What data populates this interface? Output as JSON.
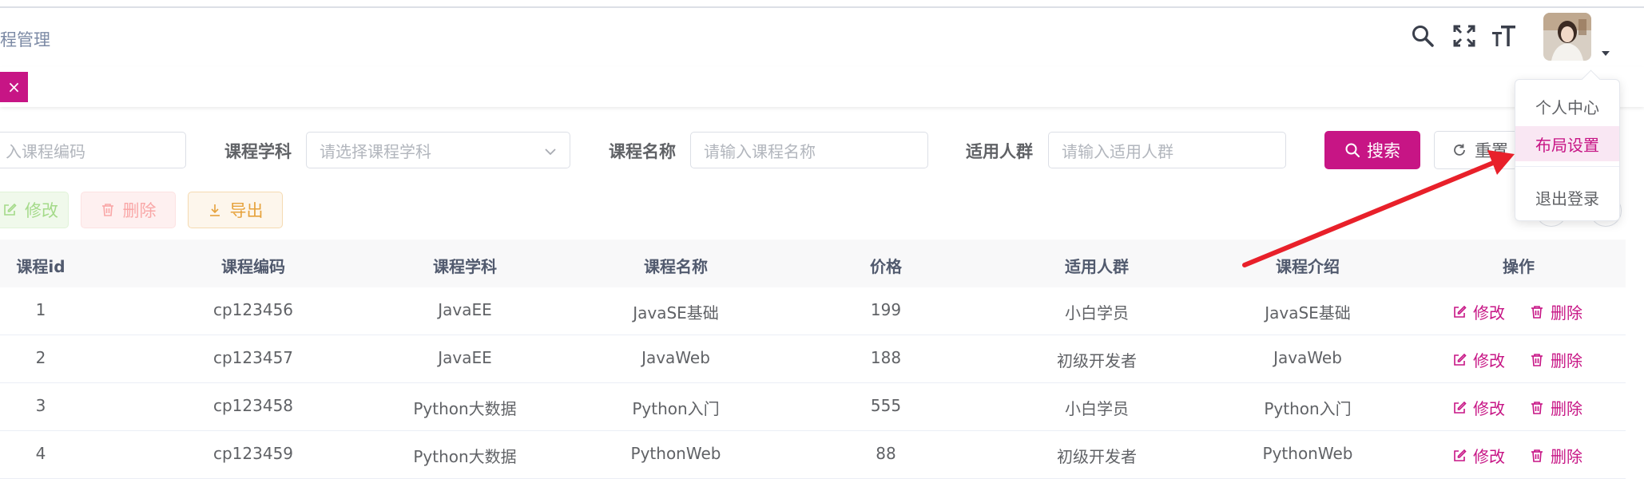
{
  "header": {
    "breadcrumb": "程管理",
    "icons": [
      "search-icon",
      "fullscreen-icon",
      "font-size-icon",
      "chevron-down-icon"
    ]
  },
  "tags": {
    "active_close": "×"
  },
  "search": {
    "code_placeholder": "入课程编码",
    "subject_label": "课程学科",
    "subject_placeholder": "请选择课程学科",
    "name_label": "课程名称",
    "name_placeholder": "请输入课程名称",
    "audience_label": "适用人群",
    "audience_placeholder": "请输入适用人群",
    "search_button": "搜索",
    "reset_button": "重置"
  },
  "toolbar": {
    "edit": "修改",
    "delete": "删除",
    "export": "导出"
  },
  "table": {
    "columns": [
      "课程id",
      "课程编码",
      "课程学科",
      "课程名称",
      "价格",
      "适用人群",
      "课程介绍",
      "操作"
    ],
    "rows": [
      [
        "1",
        "cp123456",
        "JavaEE",
        "JavaSE基础",
        "199",
        "小白学员",
        "JavaSE基础"
      ],
      [
        "2",
        "cp123457",
        "JavaEE",
        "JavaWeb",
        "188",
        "初级开发者",
        "JavaWeb"
      ],
      [
        "3",
        "cp123458",
        "Python大数据",
        "Python入门",
        "555",
        "小白学员",
        "Python入门"
      ],
      [
        "4",
        "cp123459",
        "Python大数据",
        "PythonWeb",
        "88",
        "初级开发者",
        "PythonWeb"
      ]
    ],
    "op_edit": "修改",
    "op_delete": "删除"
  },
  "dropdown": {
    "items": [
      "个人中心",
      "布局设置",
      "退出登录"
    ],
    "highlighted": "布局设置"
  },
  "colors": {
    "primary": "#c71585",
    "annotation_arrow": "#e8202a"
  }
}
